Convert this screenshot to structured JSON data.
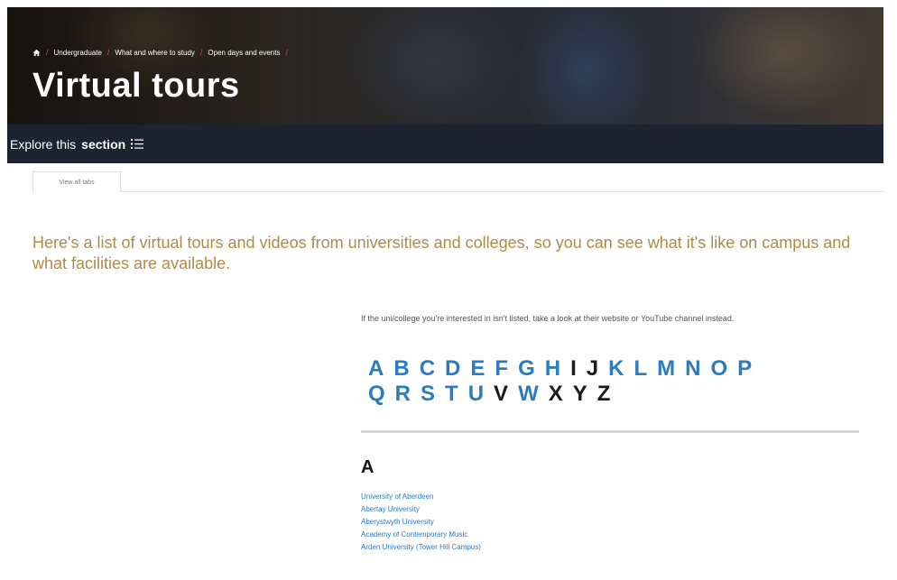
{
  "breadcrumb": {
    "home_icon": "home-icon",
    "items": [
      "Undergraduate",
      "What and where to study",
      "Open days and events"
    ],
    "separator": "/"
  },
  "hero": {
    "title": "Virtual tours"
  },
  "explore": {
    "text": "Explore this",
    "bold": "section",
    "icon": "list-icon"
  },
  "tabs": [
    {
      "label": "View all tabs"
    }
  ],
  "intro": "Here's a list of virtual tours and videos from universities and colleges, so you can see what it's like on campus and what facilities are available.",
  "note": "If the uni/college you're interested in isn't listed, take a look at their website or YouTube channel instead.",
  "az": {
    "row1": [
      {
        "letter": "A",
        "active": true
      },
      {
        "letter": "B",
        "active": true
      },
      {
        "letter": "C",
        "active": true
      },
      {
        "letter": "D",
        "active": true
      },
      {
        "letter": "E",
        "active": true
      },
      {
        "letter": "F",
        "active": true
      },
      {
        "letter": "G",
        "active": true
      },
      {
        "letter": "H",
        "active": true
      },
      {
        "letter": "I",
        "active": false
      },
      {
        "letter": "J",
        "active": false
      },
      {
        "letter": "K",
        "active": true
      },
      {
        "letter": "L",
        "active": true
      },
      {
        "letter": "M",
        "active": true
      },
      {
        "letter": "N",
        "active": true
      },
      {
        "letter": "O",
        "active": true
      },
      {
        "letter": "P",
        "active": true
      }
    ],
    "row2": [
      {
        "letter": "Q",
        "active": true
      },
      {
        "letter": "R",
        "active": true
      },
      {
        "letter": "S",
        "active": true
      },
      {
        "letter": "T",
        "active": true
      },
      {
        "letter": "U",
        "active": true
      },
      {
        "letter": "V",
        "active": false
      },
      {
        "letter": "W",
        "active": true
      },
      {
        "letter": "X",
        "active": false
      },
      {
        "letter": "Y",
        "active": false
      },
      {
        "letter": "Z",
        "active": false
      }
    ]
  },
  "section": {
    "heading": "A",
    "universities": [
      "University of Aberdeen",
      "Abertay University",
      "Aberystwyth University",
      "Academy of Contemporary Music",
      "Arden University (Tower Hill Campus)"
    ]
  },
  "colors": {
    "accent_link": "#2c7bbf",
    "intro_gold": "#b08a4a",
    "explore_bar": "#1d2330",
    "breadcrumb_separator": "#d94f3b"
  }
}
